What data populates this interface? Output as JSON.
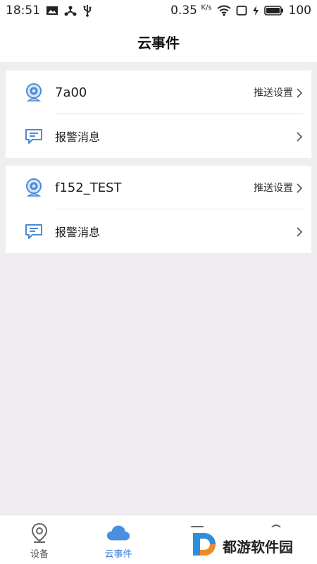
{
  "status_bar": {
    "time": "18:51",
    "speed": "0.35",
    "speed_unit": "K/s",
    "battery": "100"
  },
  "header": {
    "title": "云事件"
  },
  "devices": [
    {
      "name": "7a00",
      "push_label": "推送设置",
      "alarm_label": "报警消息"
    },
    {
      "name": "f152_TEST",
      "push_label": "推送设置",
      "alarm_label": "报警消息"
    }
  ],
  "tabs": [
    {
      "label": "设备",
      "icon": "location-pin-icon"
    },
    {
      "label": "云事件",
      "icon": "cloud-icon",
      "active": true
    },
    {
      "label": "",
      "icon": "album-icon"
    },
    {
      "label": "",
      "icon": "profile-icon"
    }
  ],
  "watermark": {
    "text": "都游软件园"
  },
  "colors": {
    "accent": "#3d7fd6",
    "background": "#efedf0",
    "divider": "#f2dde6"
  }
}
